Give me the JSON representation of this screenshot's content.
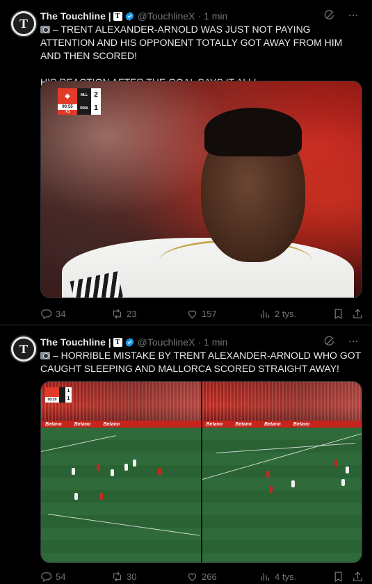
{
  "tweets": [
    {
      "author": {
        "name": "The Touchline |",
        "brand": "T",
        "handle": "@TouchlineX",
        "time": "1 min",
        "avatar_letter": "T"
      },
      "text_line1": "– TRENT ALEXANDER-ARNOLD WAS JUST NOT PAYING ATTENTION AND HIS OPPONENT TOTALLY GOT AWAY FROM HIM AND THEN SCORED!",
      "text_line2": "HIS REACTION AFTER THE GOAL SAYS IT ALL!",
      "scorebug": {
        "clock": "90:55",
        "added": "+5",
        "home": "MLL",
        "away": "RMA",
        "home_score": "2",
        "away_score": "1"
      },
      "stats": {
        "replies": "34",
        "reposts": "23",
        "likes": "157",
        "views": "2 tys."
      }
    },
    {
      "author": {
        "name": "The Touchline |",
        "brand": "T",
        "handle": "@TouchlineX",
        "time": "1 min",
        "avatar_letter": "T"
      },
      "text_line1": "– HORRIBLE MISTAKE BY TRENT ALEXANDER-ARNOLD WHO GOT CAUGHT SLEEPING AND MALLORCA SCORED STRAIGHT AWAY!",
      "scorebug": {
        "clock": "00:29",
        "home_score": "1",
        "away_score": "1"
      },
      "boards": [
        "Betano",
        "Betano",
        "Betano",
        "Betano"
      ],
      "boards_right": [
        "Betano",
        "Betano",
        "Betano",
        "Betano"
      ],
      "stats": {
        "replies": "54",
        "reposts": "30",
        "likes": "266",
        "views": "4 tys."
      }
    }
  ],
  "colors": {
    "background": "#000000",
    "text": "#e7e9ea",
    "muted": "#71767b",
    "verified": "#1d9bf0",
    "divider": "#2f3336"
  }
}
